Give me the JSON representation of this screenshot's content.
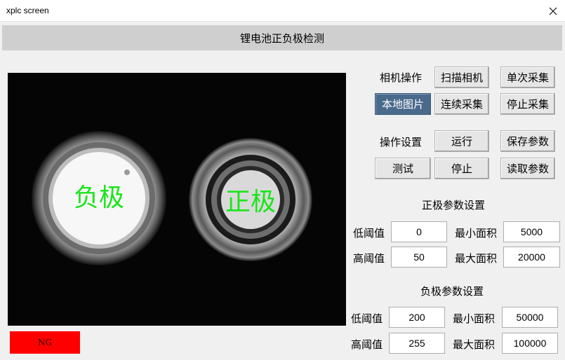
{
  "window": {
    "title": "xplc screen"
  },
  "header": {
    "title": "锂电池正负极检测"
  },
  "image": {
    "left_label": "负极",
    "right_label": "正极",
    "label_color": "#19e619"
  },
  "status": {
    "text": "NG",
    "color": "#ff0000"
  },
  "camera": {
    "label": "相机操作",
    "scan": "扫描相机",
    "single": "单次采集",
    "local": "本地图片",
    "continuous": "连续采集",
    "stop_capture": "停止采集"
  },
  "operation": {
    "label": "操作设置",
    "run": "运行",
    "save": "保存参数",
    "test": "测试",
    "stop": "停止",
    "load": "读取参数"
  },
  "positive": {
    "title": "正极参数设置",
    "low_label": "低阈值",
    "low_value": "0",
    "min_label": "最小面积",
    "min_value": "5000",
    "high_label": "高阈值",
    "high_value": "50",
    "max_label": "最大面积",
    "max_value": "20000"
  },
  "negative": {
    "title": "负极参数设置",
    "low_label": "低阈值",
    "low_value": "200",
    "min_label": "最小面积",
    "min_value": "50000",
    "high_label": "高阈值",
    "high_value": "255",
    "max_label": "最大面积",
    "max_value": "100000"
  }
}
